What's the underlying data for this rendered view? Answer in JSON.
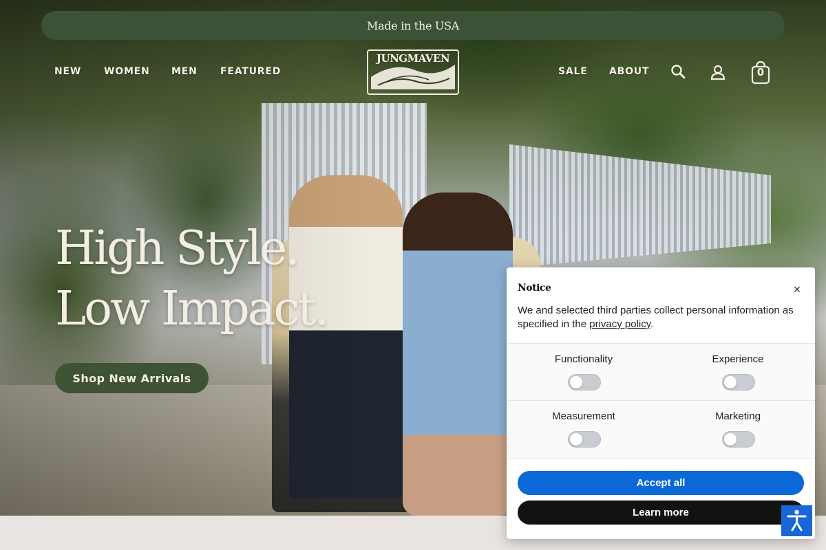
{
  "banner": {
    "text": "Made in the USA"
  },
  "nav": {
    "left": [
      "NEW",
      "WOMEN",
      "MEN",
      "FEATURED"
    ],
    "right": [
      "SALE",
      "ABOUT"
    ],
    "cart_count": "0",
    "logo_text": "JUNGMAVEN",
    "icons": [
      "search-icon",
      "account-icon",
      "cart-icon"
    ]
  },
  "hero": {
    "headline_line1": "High Style.",
    "headline_line2": "Low Impact.",
    "cta_label": "Shop New Arrivals"
  },
  "notice": {
    "title": "Notice",
    "text_before": "We and selected third parties collect personal information as specified in the ",
    "link_text": "privacy policy",
    "text_after": ".",
    "close_label": "×",
    "categories": [
      "Functionality",
      "Experience",
      "Measurement",
      "Marketing"
    ],
    "accept_label": "Accept all",
    "learn_label": "Learn more"
  },
  "accessibility": {
    "icon": "accessibility-icon"
  },
  "colors": {
    "brand_green": "#3c5236",
    "cream_text": "#f3ede2",
    "accept_blue": "#0a69d6",
    "learn_black": "#121212",
    "a11y_blue": "#1a66d6"
  }
}
